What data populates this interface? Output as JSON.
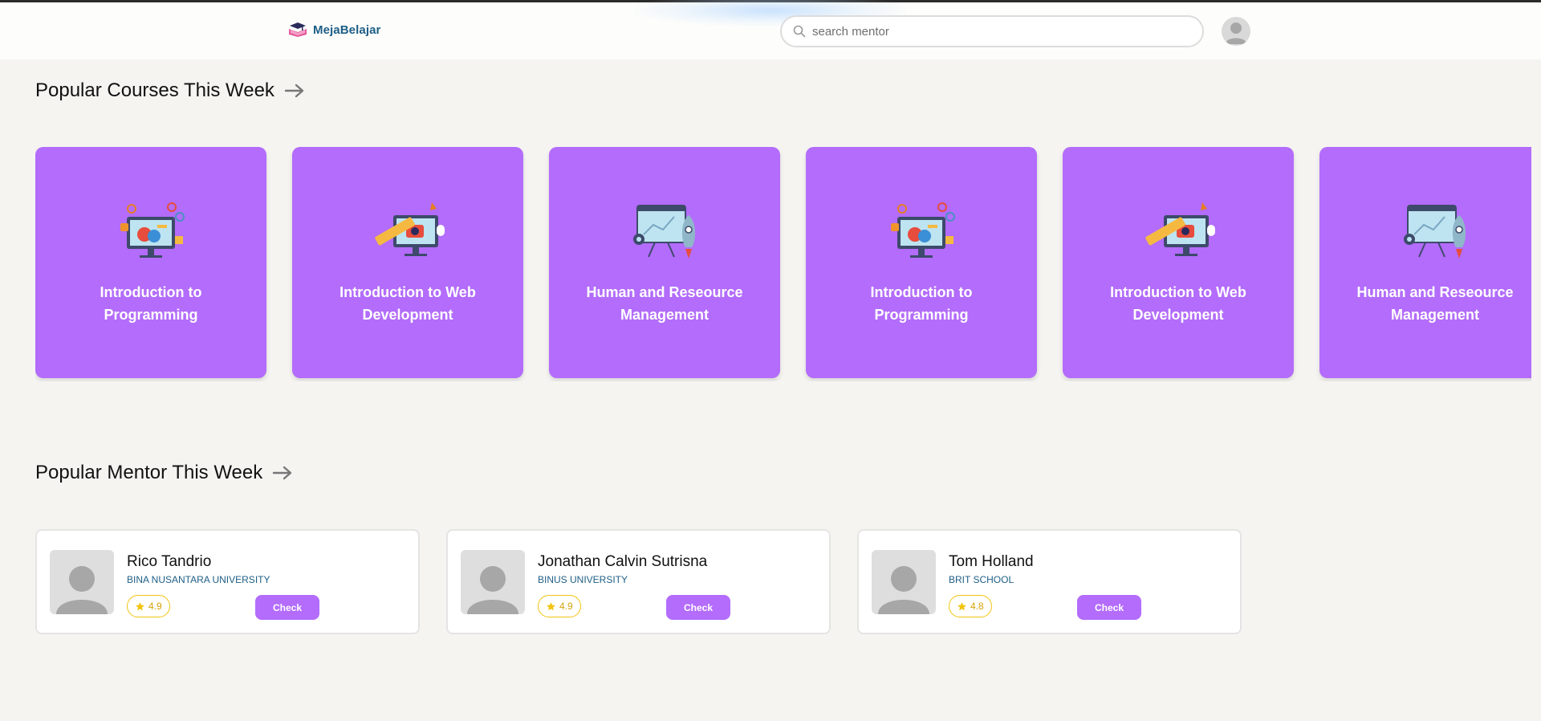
{
  "header": {
    "brand": "MejaBelajar",
    "search_placeholder": "search mentor"
  },
  "courses_section": {
    "title": "Popular Courses This Week",
    "items": [
      {
        "name": "Introduction to Programming",
        "icon": "computer-analytics-icon"
      },
      {
        "name": "Introduction to Web Development",
        "icon": "design-tools-icon"
      },
      {
        "name": "Human and Reseource Management",
        "icon": "rocket-board-icon"
      },
      {
        "name": "Introduction to Programming",
        "icon": "computer-analytics-icon"
      },
      {
        "name": "Introduction to Web Development",
        "icon": "design-tools-icon"
      },
      {
        "name": "Human and Reseource Management",
        "icon": "rocket-board-icon"
      }
    ]
  },
  "mentors_section": {
    "title": "Popular Mentor This Week",
    "check_label": "Check",
    "items": [
      {
        "name": "Rico Tandrio",
        "school": "BINA NUSANTARA UNIVERSITY",
        "rating": "4.9"
      },
      {
        "name": "Jonathan Calvin Sutrisna",
        "school": "BINUS UNIVERSITY",
        "rating": "4.9"
      },
      {
        "name": "Tom Holland",
        "school": "BRIT SCHOOL",
        "rating": "4.8"
      }
    ]
  },
  "colors": {
    "accent": "#b36cfb",
    "brand_text": "#1d5e86",
    "rating": "#f1c40f",
    "background": "#f5f4f1"
  }
}
